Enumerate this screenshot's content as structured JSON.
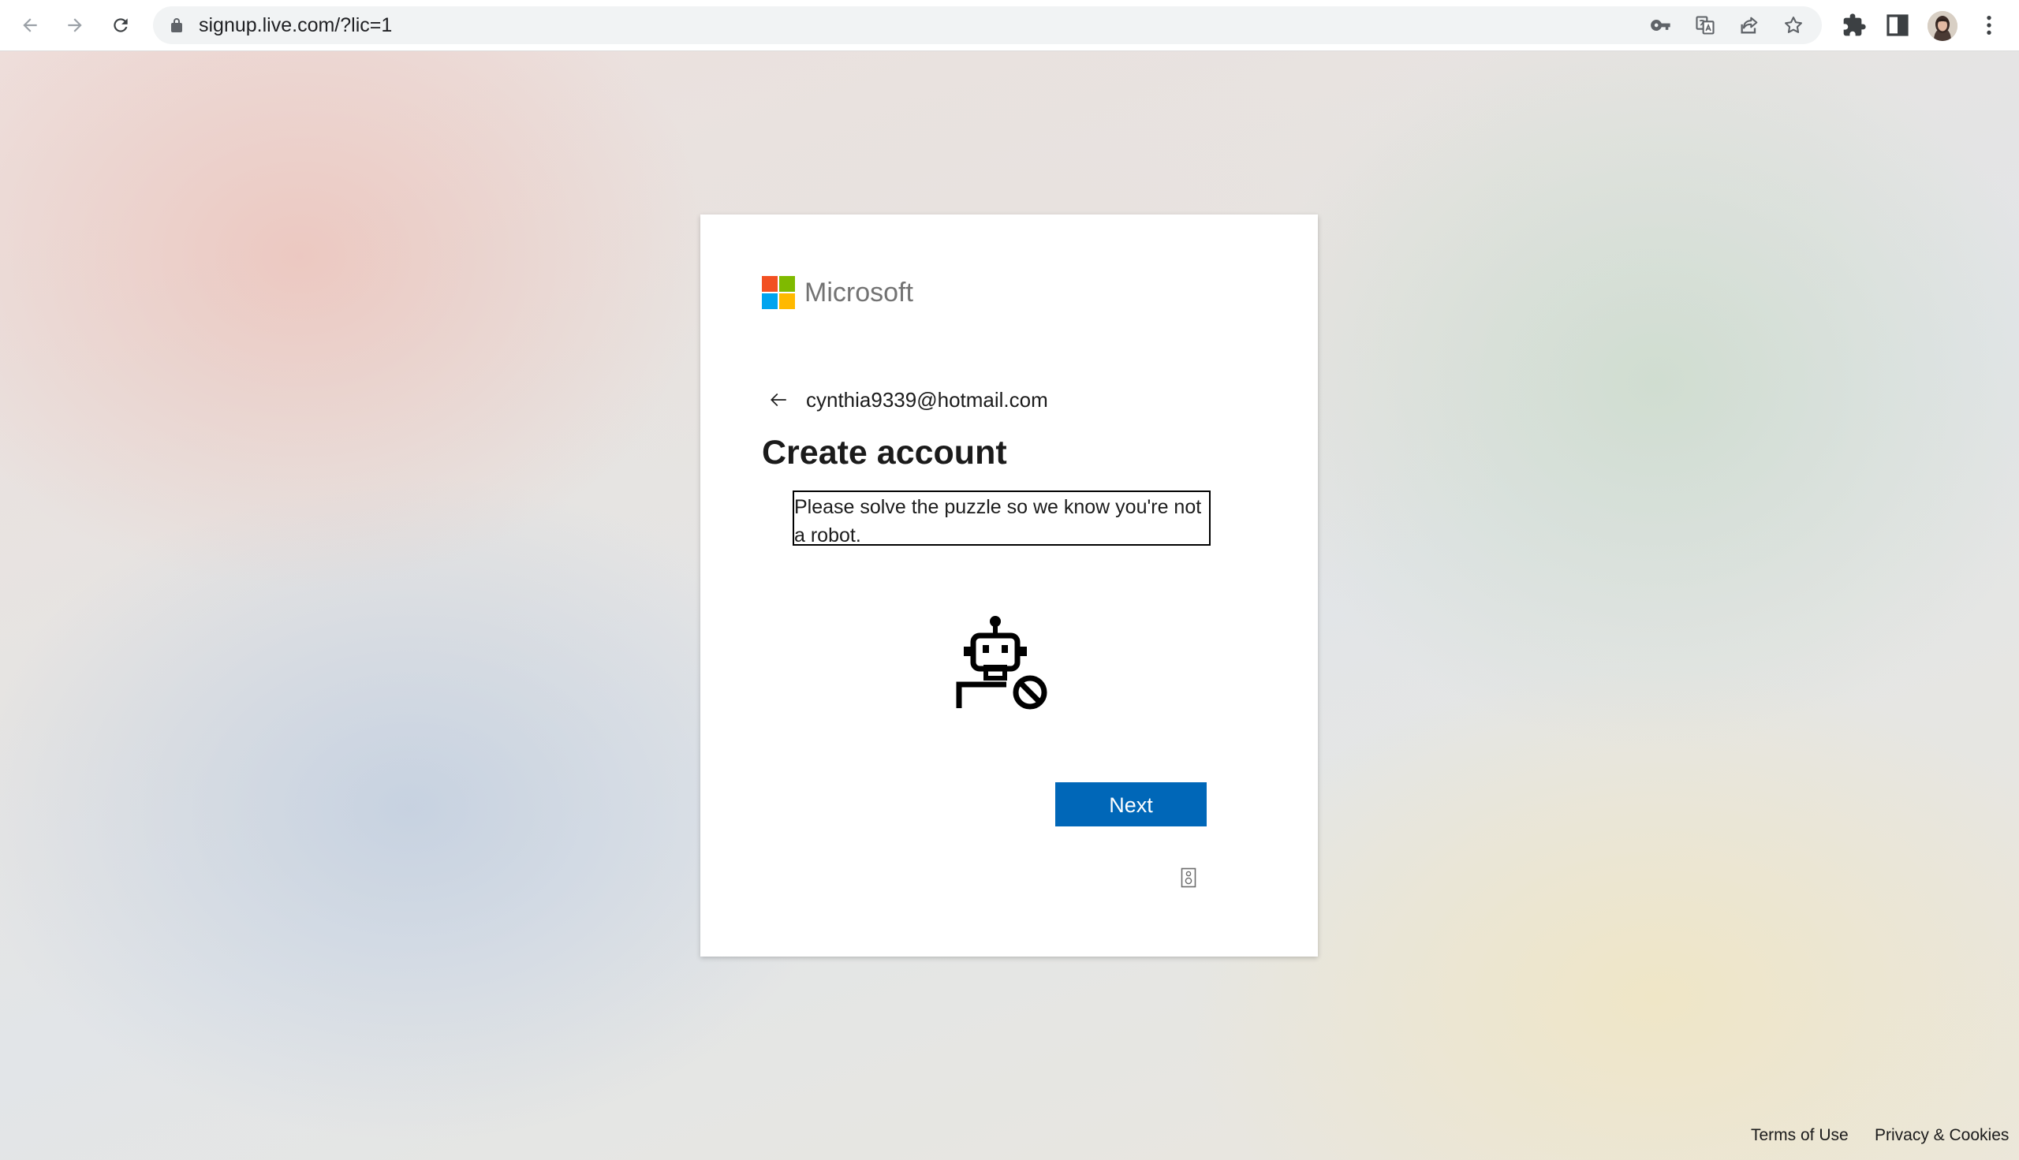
{
  "browser": {
    "url": "signup.live.com/?lic=1"
  },
  "card": {
    "brand": "Microsoft",
    "email": "cynthia9339@hotmail.com",
    "title": "Create account",
    "puzzle_message": "Please solve the puzzle so we know you're not a robot.",
    "next_label": "Next"
  },
  "footer": {
    "terms": "Terms of Use",
    "privacy": "Privacy & Cookies"
  },
  "colors": {
    "brand_blue": "#0067b8",
    "ms_red": "#f25022",
    "ms_green": "#7fba00",
    "ms_blue": "#00a4ef",
    "ms_yellow": "#ffb900"
  },
  "icons": {
    "back": "arrow-left-icon",
    "forward": "arrow-right-icon",
    "reload": "reload-icon",
    "lock": "lock-icon",
    "key": "key-icon",
    "translate": "translate-icon",
    "share": "share-icon",
    "star": "star-icon",
    "extensions": "puzzle-piece-icon",
    "side_panel": "side-panel-icon",
    "menu": "kebab-menu-icon",
    "robot": "robot-blocked-icon"
  }
}
